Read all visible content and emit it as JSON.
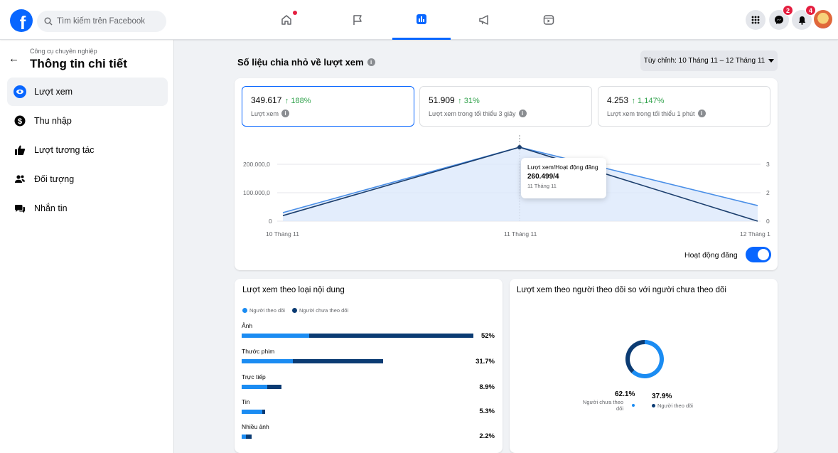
{
  "header": {
    "logo_letter": "f",
    "search_placeholder": "Tìm kiếm trên Facebook",
    "tabs": [
      {
        "name": "home-icon",
        "active": false
      },
      {
        "name": "flag-icon",
        "active": false
      },
      {
        "name": "insights-icon",
        "active": true
      },
      {
        "name": "megaphone-icon",
        "active": false
      },
      {
        "name": "video-icon",
        "active": false
      }
    ],
    "messenger_badge": "2",
    "notifications_badge": "4"
  },
  "sidebar": {
    "subtitle": "Công cụ chuyên nghiệp",
    "title": "Thông tin chi tiết",
    "items": [
      {
        "label": "Lượt xem",
        "active": true
      },
      {
        "label": "Thu nhập",
        "active": false
      },
      {
        "label": "Lượt tương tác",
        "active": false
      },
      {
        "label": "Đối tượng",
        "active": false
      },
      {
        "label": "Nhắn tin",
        "active": false
      }
    ]
  },
  "main": {
    "title": "Số liệu chia nhỏ về lượt xem",
    "date_range": "Tùy chỉnh: 10 Tháng 11 – 12 Tháng 11",
    "metrics": [
      {
        "value": "349.617",
        "change": "↑ 188%",
        "label": "Lượt xem"
      },
      {
        "value": "51.909",
        "change": "↑ 31%",
        "label": "Lượt xem trong tối thiểu 3 giây"
      },
      {
        "value": "4.253",
        "change": "↑ 1,147%",
        "label": "Lượt xem trong tối thiểu 1 phút"
      }
    ],
    "tooltip": {
      "title": "Lượt xem/Hoạt động đăng",
      "value": "260.499/4",
      "date": "11 Tháng 11"
    },
    "toggle_label": "Hoạt động đăng",
    "toggle_on": true
  },
  "chart_data": [
    {
      "type": "line",
      "x": [
        "10 Tháng 11",
        "11 Tháng 11",
        "12 Tháng 1"
      ],
      "series": [
        {
          "name": "Lượt xem",
          "values": [
            30000,
            260499,
            55000
          ],
          "axis": "left",
          "color": "#4a8fe7"
        },
        {
          "name": "Hoạt động đăng",
          "values": [
            0.3,
            4,
            0
          ],
          "axis": "right",
          "color": "#1c3f6e"
        }
      ],
      "yticks_left": [
        "0",
        "100.000,0",
        "200.000,0"
      ],
      "yticks_right": [
        "0",
        "2",
        "3"
      ],
      "ylim_left": [
        0,
        260499
      ],
      "ylim_right": [
        0,
        4
      ],
      "grid": true
    },
    {
      "type": "bar",
      "title": "Lượt xem theo loại nội dung",
      "legend": [
        "Người theo dõi",
        "Người chưa theo dõi"
      ],
      "categories": [
        "Ảnh",
        "Thước phim",
        "Trực tiếp",
        "Tin",
        "Nhiều ảnh"
      ],
      "totals": [
        52,
        31.7,
        8.9,
        5.3,
        2.2
      ],
      "labels": [
        "52%",
        "31.7%",
        "8.9%",
        "5.3%",
        "2.2%"
      ],
      "follower_share": [
        0.29,
        0.36,
        0.64,
        0.88,
        0.4
      ],
      "colors": {
        "followers": "#1b8cf2",
        "non_followers": "#0b3b73"
      }
    },
    {
      "type": "pie",
      "title": "Lượt xem theo người theo dõi so với người chưa theo dõi",
      "slices": [
        {
          "label": "Người chưa theo dõi",
          "value": 62.1,
          "display": "62.1%",
          "color": "#1b8cf2"
        },
        {
          "label": "Người theo dõi",
          "value": 37.9,
          "display": "37.9%",
          "color": "#0b3b73"
        }
      ]
    }
  ],
  "colors": {
    "accent": "#0866ff",
    "positive": "#31a24c",
    "followers": "#1b8cf2",
    "non_followers": "#0b3b73"
  }
}
